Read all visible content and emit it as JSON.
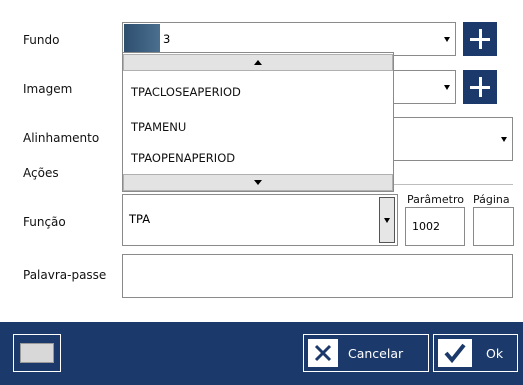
{
  "form": {
    "fundo_label": "Fundo",
    "fundo_value": "3",
    "imagem_label": "Imagem",
    "alinhamento_label": "Alinhamento",
    "acoes_label": "Ações",
    "funcao_label": "Função",
    "funcao_value": "TPA",
    "parametro_label": "Parâmetro",
    "parametro_value": "1002",
    "pagina_label": "Página",
    "pagina_value": "",
    "palavra_passe_label": "Palavra-passe",
    "palavra_passe_value": ""
  },
  "dropdown": {
    "options": [
      "TPACLOSEAPERIOD",
      "TPAMENU",
      "TPAOPENAPERIOD"
    ]
  },
  "footer": {
    "cancel_label": "Cancelar",
    "ok_label": "Ok"
  },
  "colors": {
    "accent": "#1b3a6b",
    "swatch": "#3b5f80"
  },
  "icons": [
    "plus-icon",
    "keyboard-icon",
    "close-x-icon",
    "check-icon",
    "chevron-down-icon",
    "chevron-up-icon"
  ]
}
